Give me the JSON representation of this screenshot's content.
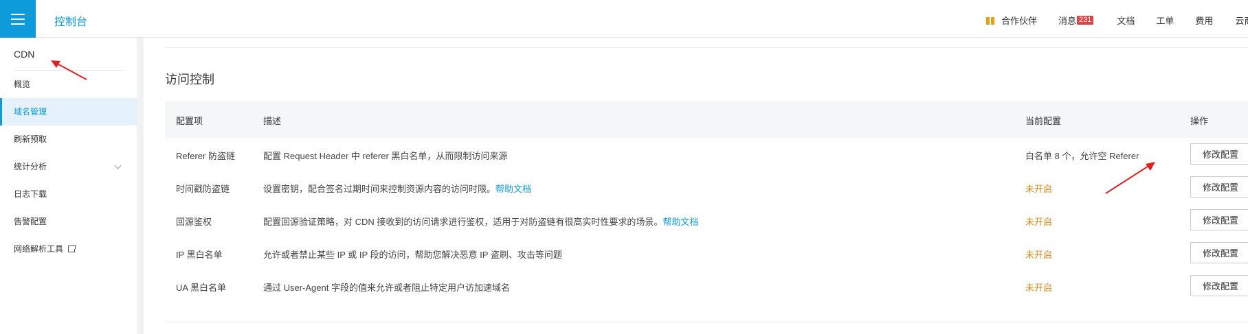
{
  "header": {
    "console_title": "控制台",
    "nav": {
      "partner": "合作伙伴",
      "messages": "消息",
      "messages_count": "231",
      "docs": "文档",
      "tickets": "工单",
      "billing": "费用",
      "cloud_partial": "云商"
    }
  },
  "sidebar": {
    "title": "CDN",
    "items": [
      {
        "label": "概览"
      },
      {
        "label": "域名管理"
      },
      {
        "label": "刷新预取"
      },
      {
        "label": "统计分析"
      },
      {
        "label": "日志下载"
      },
      {
        "label": "告警配置"
      },
      {
        "label": "网络解析工具"
      }
    ]
  },
  "main": {
    "section_title": "访问控制",
    "columns": [
      "配置项",
      "描述",
      "当前配置",
      "操作"
    ],
    "rows": [
      {
        "name": "Referer 防盗链",
        "desc": "配置 Request Header 中 referer 黑白名单，从而限制访问来源",
        "help": "",
        "status": "白名单 8 个，允许空 Referer",
        "action": "修改配置"
      },
      {
        "name": "时间戳防盗链",
        "desc": "设置密钥，配合签名过期时间来控制资源内容的访问时限。",
        "help": "帮助文档",
        "status": "未开启",
        "action": "修改配置"
      },
      {
        "name": "回源鉴权",
        "desc": "配置回源验证策略，对 CDN 接收到的访问请求进行鉴权，适用于对防盗链有很高实时性要求的场景。",
        "help": "帮助文档",
        "status": "未开启",
        "action": "修改配置"
      },
      {
        "name": "IP 黑白名单",
        "desc": "允许或者禁止某些 IP 或 IP 段的访问，帮助您解决恶意 IP 盗刷、攻击等问题",
        "help": "",
        "status": "未开启",
        "action": "修改配置"
      },
      {
        "name": "UA 黑白名单",
        "desc": "通过 User-Agent 字段的值来允许或者阻止特定用户访加速域名",
        "help": "",
        "status": "未开启",
        "action": "修改配置"
      }
    ]
  },
  "colors": {
    "brand": "#0d9bdb",
    "off_status": "#d4891a",
    "partner": "#e8a010",
    "badge": "#e04444",
    "annotation": "#e02020"
  }
}
